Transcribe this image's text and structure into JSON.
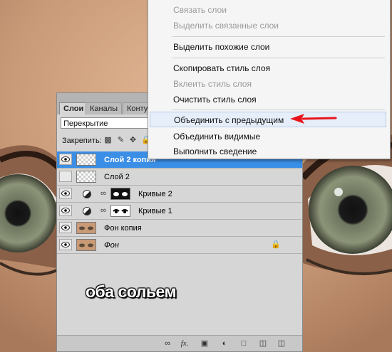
{
  "layers_panel": {
    "tabs": [
      "Слои",
      "Каналы",
      "Конту"
    ],
    "blend_mode": "Перекрытие",
    "lock_label": "Закрепить:",
    "layers": [
      {
        "name": "Слой 2 копия",
        "selected": true,
        "visible": true,
        "thumb": "transparent"
      },
      {
        "name": "Слой 2",
        "selected": false,
        "visible": false,
        "thumb": "transparent"
      },
      {
        "name": "Кривые 2",
        "selected": false,
        "visible": true,
        "thumb": "curves-mask"
      },
      {
        "name": "Кривые 1",
        "selected": false,
        "visible": true,
        "thumb": "curves-mask"
      },
      {
        "name": "Фон копия",
        "selected": false,
        "visible": true,
        "thumb": "photo"
      },
      {
        "name": "Фон",
        "selected": false,
        "visible": true,
        "thumb": "photo",
        "locked": true
      }
    ],
    "bottom_icons": [
      "link-icon",
      "fx-icon",
      "mask-icon",
      "adjustment-icon",
      "group-icon",
      "new-layer-icon",
      "trash-icon"
    ]
  },
  "context_menu": {
    "items": [
      {
        "label": "Связать слои",
        "disabled": true
      },
      {
        "label": "Выделить связанные слои",
        "disabled": true
      },
      {
        "label": "Выделить похожие слои",
        "disabled": false
      },
      {
        "label": "Скопировать стиль слоя",
        "disabled": false
      },
      {
        "label": "Вклеить стиль слоя",
        "disabled": true
      },
      {
        "label": "Очистить стиль слоя",
        "disabled": false
      },
      {
        "label": "Объединить с предыдущим",
        "disabled": false,
        "highlighted": true
      },
      {
        "label": "Объединить видимые",
        "disabled": false
      },
      {
        "label": "Выполнить сведение",
        "disabled": false
      }
    ]
  },
  "caption": "оба сольем",
  "colors": {
    "selected_layer": "#3a8ee6",
    "arrow": "#e8141c",
    "skin": "#c99b7a"
  }
}
